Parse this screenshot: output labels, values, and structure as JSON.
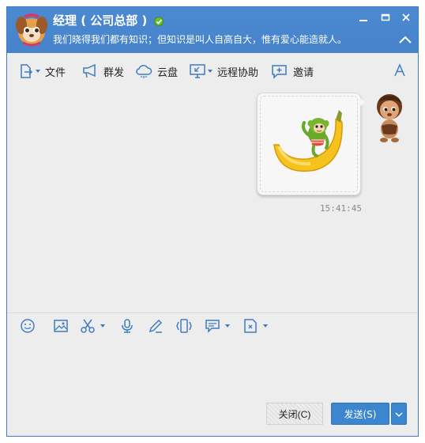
{
  "window": {
    "title": "经理 ( 公司总部 )",
    "signature": "我们晓得我们都有知识；但知识是叫人自高自大，惟有爱心能造就人。"
  },
  "toolbar": {
    "items": [
      {
        "label": "文件",
        "icon": "file-send-icon"
      },
      {
        "label": "群发",
        "icon": "broadcast-icon"
      },
      {
        "label": "云盘",
        "icon": "cloud-icon"
      },
      {
        "label": "远程协助",
        "icon": "remote-assist-icon"
      },
      {
        "label": "邀请",
        "icon": "invite-icon"
      }
    ],
    "font_icon": "font-icon"
  },
  "chat": {
    "message_time": "15:41:45",
    "sticker": "banana-monkey-sticker"
  },
  "input_toolbar": {
    "icons": [
      "emoji-icon",
      "image-icon",
      "scissors-icon",
      "microphone-icon",
      "pen-icon",
      "shake-icon",
      "message-history-icon",
      "document-icon"
    ]
  },
  "footer": {
    "close_label": "关闭(C)",
    "send_label": "发送(S)"
  },
  "colors": {
    "titlebar": "#4683cb",
    "accent": "#3c86d0",
    "icon": "#3f7bc1"
  }
}
